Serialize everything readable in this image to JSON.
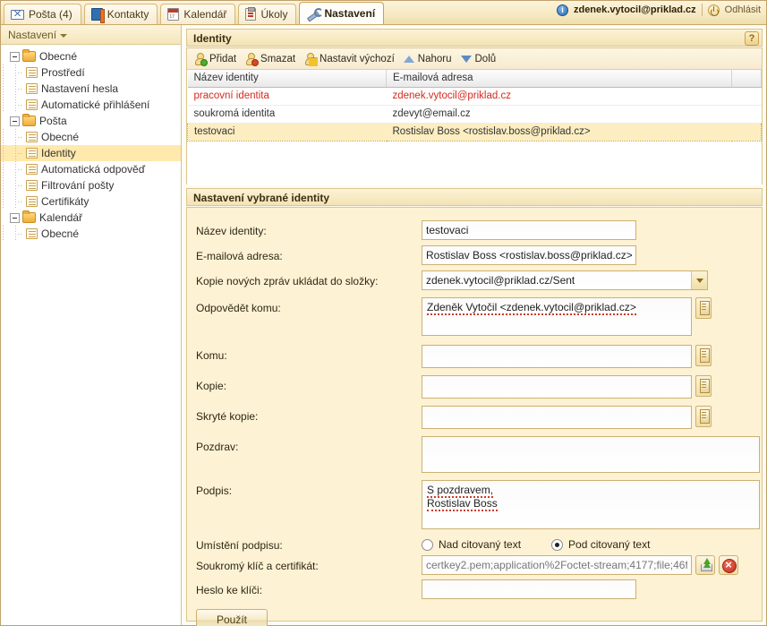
{
  "tabs": [
    {
      "label": "Pošta (4)",
      "icon": "mail-icon",
      "active": false
    },
    {
      "label": "Kontakty",
      "icon": "book-icon",
      "active": false
    },
    {
      "label": "Kalendář",
      "icon": "calendar-icon",
      "active": false
    },
    {
      "label": "Úkoly",
      "icon": "task-icon",
      "active": false
    },
    {
      "label": "Nastavení",
      "icon": "wrench-icon",
      "active": true
    }
  ],
  "user": {
    "email": "zdenek.vytocil@priklad.cz",
    "logout_label": "Odhlásit"
  },
  "sidebar": {
    "header": "Nastavení",
    "items": [
      {
        "label": "Obecné",
        "type": "folder",
        "level": 0,
        "selected": false
      },
      {
        "label": "Prostředí",
        "type": "page",
        "level": 1,
        "selected": false
      },
      {
        "label": "Nastavení hesla",
        "type": "page",
        "level": 1,
        "selected": false
      },
      {
        "label": "Automatické přihlášení",
        "type": "page",
        "level": 1,
        "selected": false
      },
      {
        "label": "Pošta",
        "type": "folder",
        "level": 0,
        "selected": false
      },
      {
        "label": "Obecné",
        "type": "page",
        "level": 1,
        "selected": false
      },
      {
        "label": "Identity",
        "type": "page",
        "level": 1,
        "selected": true
      },
      {
        "label": "Automatická odpověď",
        "type": "page",
        "level": 1,
        "selected": false
      },
      {
        "label": "Filtrování pošty",
        "type": "page",
        "level": 1,
        "selected": false
      },
      {
        "label": "Certifikáty",
        "type": "page",
        "level": 1,
        "selected": false
      },
      {
        "label": "Kalendář",
        "type": "folder",
        "level": 0,
        "selected": false
      },
      {
        "label": "Obecné",
        "type": "page",
        "level": 1,
        "selected": false
      }
    ]
  },
  "identity_panel": {
    "title": "Identity",
    "help_label": "?",
    "toolbar": [
      {
        "label": "Přidat",
        "icon": "user-add-icon"
      },
      {
        "label": "Smazat",
        "icon": "user-delete-icon"
      },
      {
        "label": "Nastavit výchozí",
        "icon": "user-default-icon"
      },
      {
        "label": "Nahoru",
        "icon": "arrow-up-icon"
      },
      {
        "label": "Dolů",
        "icon": "arrow-down-icon"
      }
    ],
    "columns": [
      "Název identity",
      "E-mailová adresa",
      ""
    ],
    "rows": [
      {
        "name": "pracovní identita",
        "email": "zdenek.vytocil@priklad.cz",
        "default": true,
        "selected": false
      },
      {
        "name": "soukromá identita",
        "email": "zdevyt@email.cz",
        "default": false,
        "selected": false
      },
      {
        "name": "testovaci",
        "email": "Rostislav Boss <rostislav.boss@priklad.cz>",
        "default": false,
        "selected": true
      }
    ]
  },
  "settings_panel": {
    "title": "Nastavení vybrané identity",
    "fields": {
      "name_label": "Název identity:",
      "name_value": "testovaci",
      "email_label": "E-mailová adresa:",
      "email_value": "Rostislav Boss <rostislav.boss@priklad.cz>",
      "sent_folder_label": "Kopie nových zpráv ukládat do složky:",
      "sent_folder_value": "zdenek.vytocil@priklad.cz/Sent",
      "reply_to_label": "Odpovědět komu:",
      "reply_to_value": "Zdeněk Vytočil <zdenek.vytocil@priklad.cz>",
      "to_label": "Komu:",
      "to_value": "",
      "cc_label": "Kopie:",
      "cc_value": "",
      "bcc_label": "Skryté kopie:",
      "bcc_value": "",
      "greeting_label": "Pozdrav:",
      "greeting_value": "",
      "signature_label": "Podpis:",
      "signature_line1": "S pozdravem,",
      "signature_line2": "Rostislav Boss",
      "sig_position_label": "Umístění podpisu:",
      "sig_position_options": [
        {
          "label": "Nad citovaný text",
          "selected": false
        },
        {
          "label": "Pod citovaný text",
          "selected": true
        }
      ],
      "cert_label": "Soukromý klíč a certifikát:",
      "cert_value": "certkey2.pem;application%2Foctet-stream;4177;file;46f",
      "cert_upload_icon": "upload-icon",
      "cert_remove_icon": "remove-icon",
      "key_password_label": "Heslo ke klíči:",
      "key_password_value": "",
      "apply_label": "Použít"
    }
  },
  "colors": {
    "accent": "#f0d48a",
    "panel_bg": "#fdf2d4",
    "selection": "#ffe9ad",
    "default_identity": "#d42a1e"
  }
}
